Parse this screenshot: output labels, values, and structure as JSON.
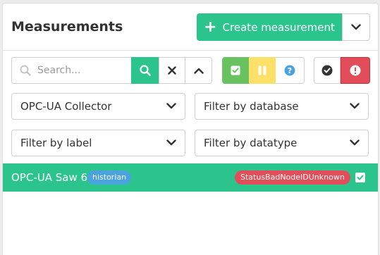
{
  "header": {
    "title": "Measurements",
    "create_label": "Create measurement"
  },
  "toolbar": {
    "search_placeholder": "Search...",
    "icons": [
      "search-icon",
      "clear-icon",
      "chevron-up-icon",
      "check-square-icon",
      "pause-icon",
      "question-circle-icon",
      "check-circle-icon",
      "exclamation-circle-icon"
    ]
  },
  "filters": {
    "collector": "OPC-UA Collector",
    "database": "Filter by database",
    "label": "Filter by label",
    "datatype": "Filter by datatype"
  },
  "measurements": [
    {
      "name": "OPC-UA Saw 6",
      "tag": "historian",
      "status": "StatusBadNodeIDUnknown",
      "checked": true
    }
  ],
  "colors": {
    "accent": "#2bc48d",
    "ok": "#67c25f",
    "warn": "#fde068",
    "error": "#e34d59",
    "info": "#4aa3df"
  }
}
